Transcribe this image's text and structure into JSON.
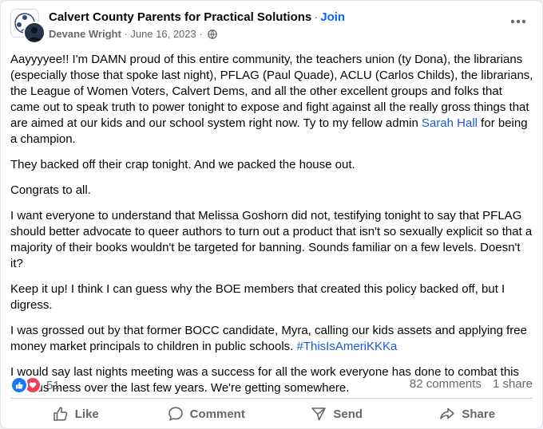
{
  "post": {
    "group_name": "Calvert County Parents for Practical Solutions",
    "separator": "·",
    "join_label": "Join",
    "author": "Devane Wright",
    "date_sep": " · ",
    "date": "June 16, 2023",
    "date_tail": " · "
  },
  "body": {
    "p1_a": "Aayyyyee!! I'm DAMN proud of this entire community, the teachers union (ty Dona), the librarians (especially those that spoke last night), PFLAG (Paul Quade), ACLU (Carlos Childs), the librarians, the League of Women Voters, Calvert Dems, and all the other excellent groups and folks that came out to speak truth to power tonight to expose and fight against all the really gross things that are aimed at our kids and our school system right now. Ty to my fellow admin ",
    "p1_link": "Sarah Hall",
    "p1_b": " for being a champion.",
    "p2": "They backed off their crap tonight. And we packed the house out.",
    "p3": "Congrats to all.",
    "p4": "I want everyone to understand that Melissa Goshorn did not, testifying tonight to say that PFLAG should better advocate to queer authors to turn out a product that isn't so sexually explicit so that a majority of their books wouldn't be targeted for banning.  Sounds familiar on a few levels. Doesn't it?",
    "p5": "Keep it up! I think I can guess why the BOE members that created this policy backed off, but I digress.",
    "p6_a": "I was grossed out by that former BOCC candidate, Myra, calling our kids assets and applying free money market principals to children in public schools. ",
    "p6_tag": "#ThisIsAmeriKKKa",
    "p7": "I would say last nights meeting was a success for all the work everyone has done to combat this various mess over the last few years. We're getting somewhere."
  },
  "stats": {
    "reaction_count": "51",
    "comments": "82 comments",
    "shares": "1 share"
  },
  "actions": {
    "like": "Like",
    "comment": "Comment",
    "send": "Send",
    "share": "Share"
  },
  "colors": {
    "link": "#1a5ad6",
    "join": "#0866ff",
    "like_react": "#1877f2",
    "love_react": "#f33e58",
    "muted": "#65676b"
  },
  "icons": [
    "group-logo-icon",
    "globe-icon",
    "more-options-icon",
    "like-reaction-icon",
    "love-reaction-icon",
    "thumbs-up-icon",
    "comment-icon",
    "send-icon",
    "share-icon"
  ]
}
